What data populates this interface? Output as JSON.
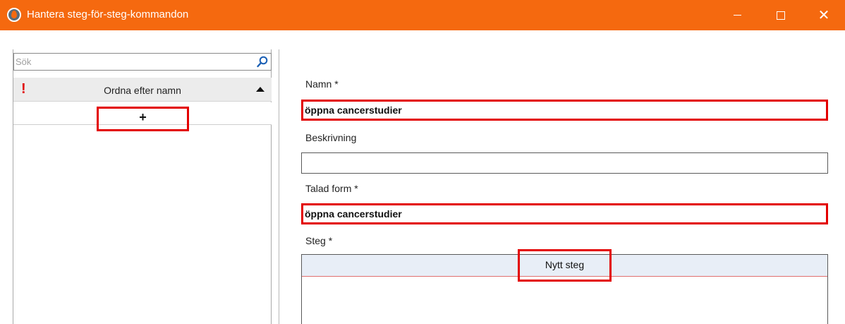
{
  "window": {
    "title": "Hantera steg-för-steg-kommandon",
    "icons": {
      "app": "app-flame-icon",
      "minimize": "minimize-icon",
      "maximize": "maximize-icon",
      "close": "close-icon"
    },
    "close_glyph": "✕",
    "accent_color": "#f5690f"
  },
  "sidebar": {
    "search": {
      "placeholder": "Sök",
      "value": "",
      "icon": "search-icon"
    },
    "sort": {
      "excl_glyph": "!",
      "label": "Ordna efter namn",
      "icon": "sort-ascending-icon"
    },
    "add_label": "+"
  },
  "form": {
    "name": {
      "label": "Namn *",
      "value": "öppna cancerstudier"
    },
    "description": {
      "label": "Beskrivning",
      "value": ""
    },
    "spoken_form": {
      "label": "Talad form *",
      "value": "öppna cancerstudier"
    },
    "steps": {
      "label": "Steg *",
      "new_step_label": "Nytt steg"
    }
  },
  "colors": {
    "highlight": "#e30000",
    "title_bar": "#f5690f",
    "step_row": "#e8eef7"
  }
}
